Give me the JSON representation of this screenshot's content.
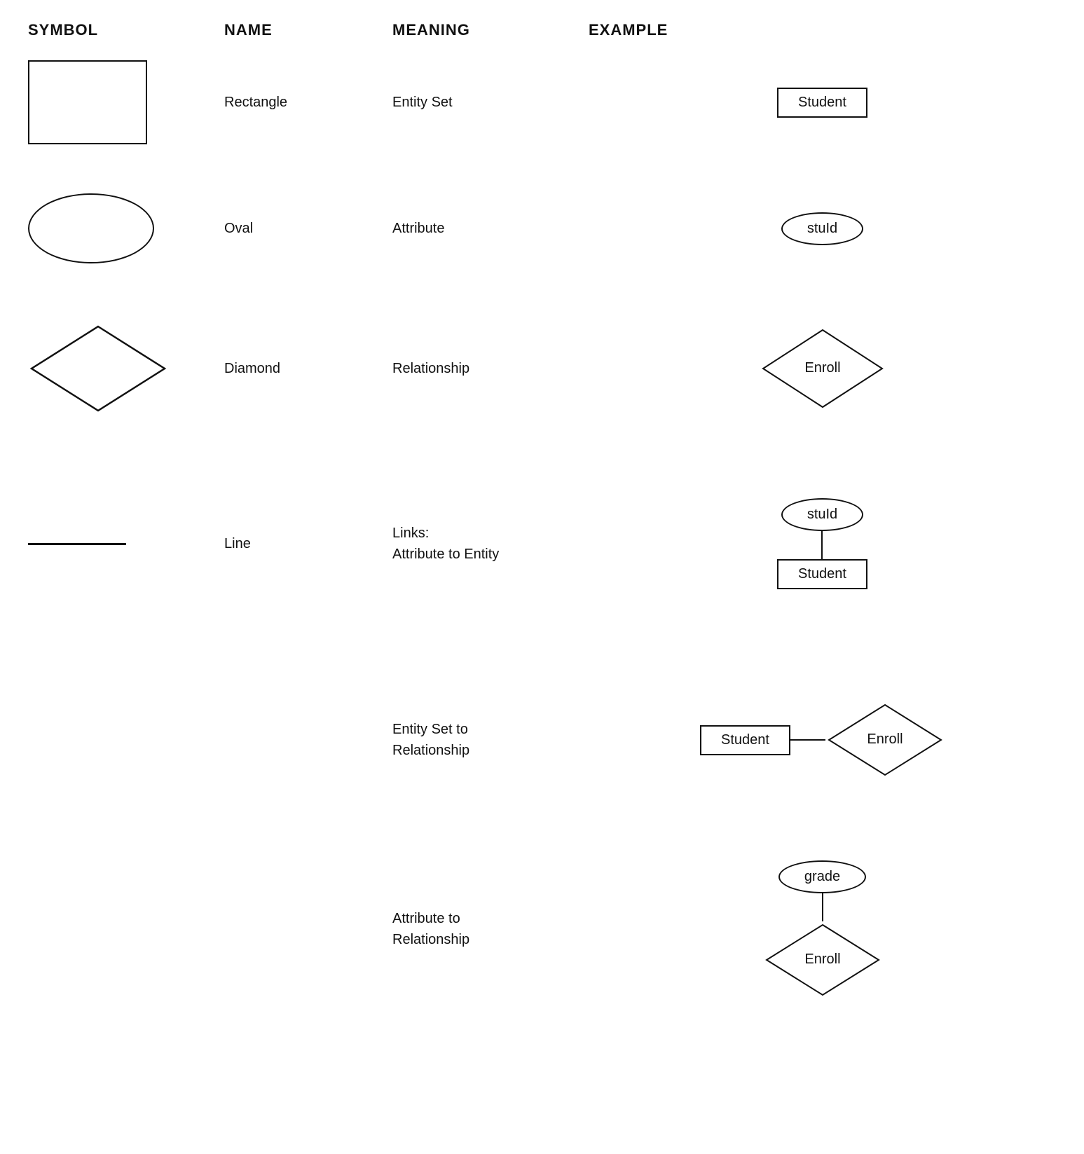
{
  "header": {
    "col1": "SYMBOL",
    "col2": "NAME",
    "col3": "MEANING",
    "col4": "EXAMPLE"
  },
  "rows": [
    {
      "id": "rectangle",
      "name": "Rectangle",
      "meaning": "Entity Set",
      "example_label": "Student",
      "example_type": "rect"
    },
    {
      "id": "oval",
      "name": "Oval",
      "meaning": "Attribute",
      "example_label": "stuId",
      "example_type": "oval"
    },
    {
      "id": "diamond",
      "name": "Diamond",
      "meaning": "Relationship",
      "example_label": "Enroll",
      "example_type": "diamond"
    },
    {
      "id": "line",
      "name": "Line",
      "meaning": "Links:\nAttribute to Entity",
      "example_type": "link",
      "example_oval_label": "stuId",
      "example_rect_label": "Student"
    }
  ],
  "meaning_rows": [
    {
      "id": "entity-set-to-relationship",
      "meaning": "Entity Set to\nRelationship",
      "example_type": "ent-rel",
      "rect_label": "Student",
      "diamond_label": "Enroll"
    },
    {
      "id": "attribute-to-relationship",
      "meaning": "Attribute to\nRelationship",
      "example_type": "attr-rel",
      "oval_label": "grade",
      "diamond_label": "Enroll"
    }
  ]
}
